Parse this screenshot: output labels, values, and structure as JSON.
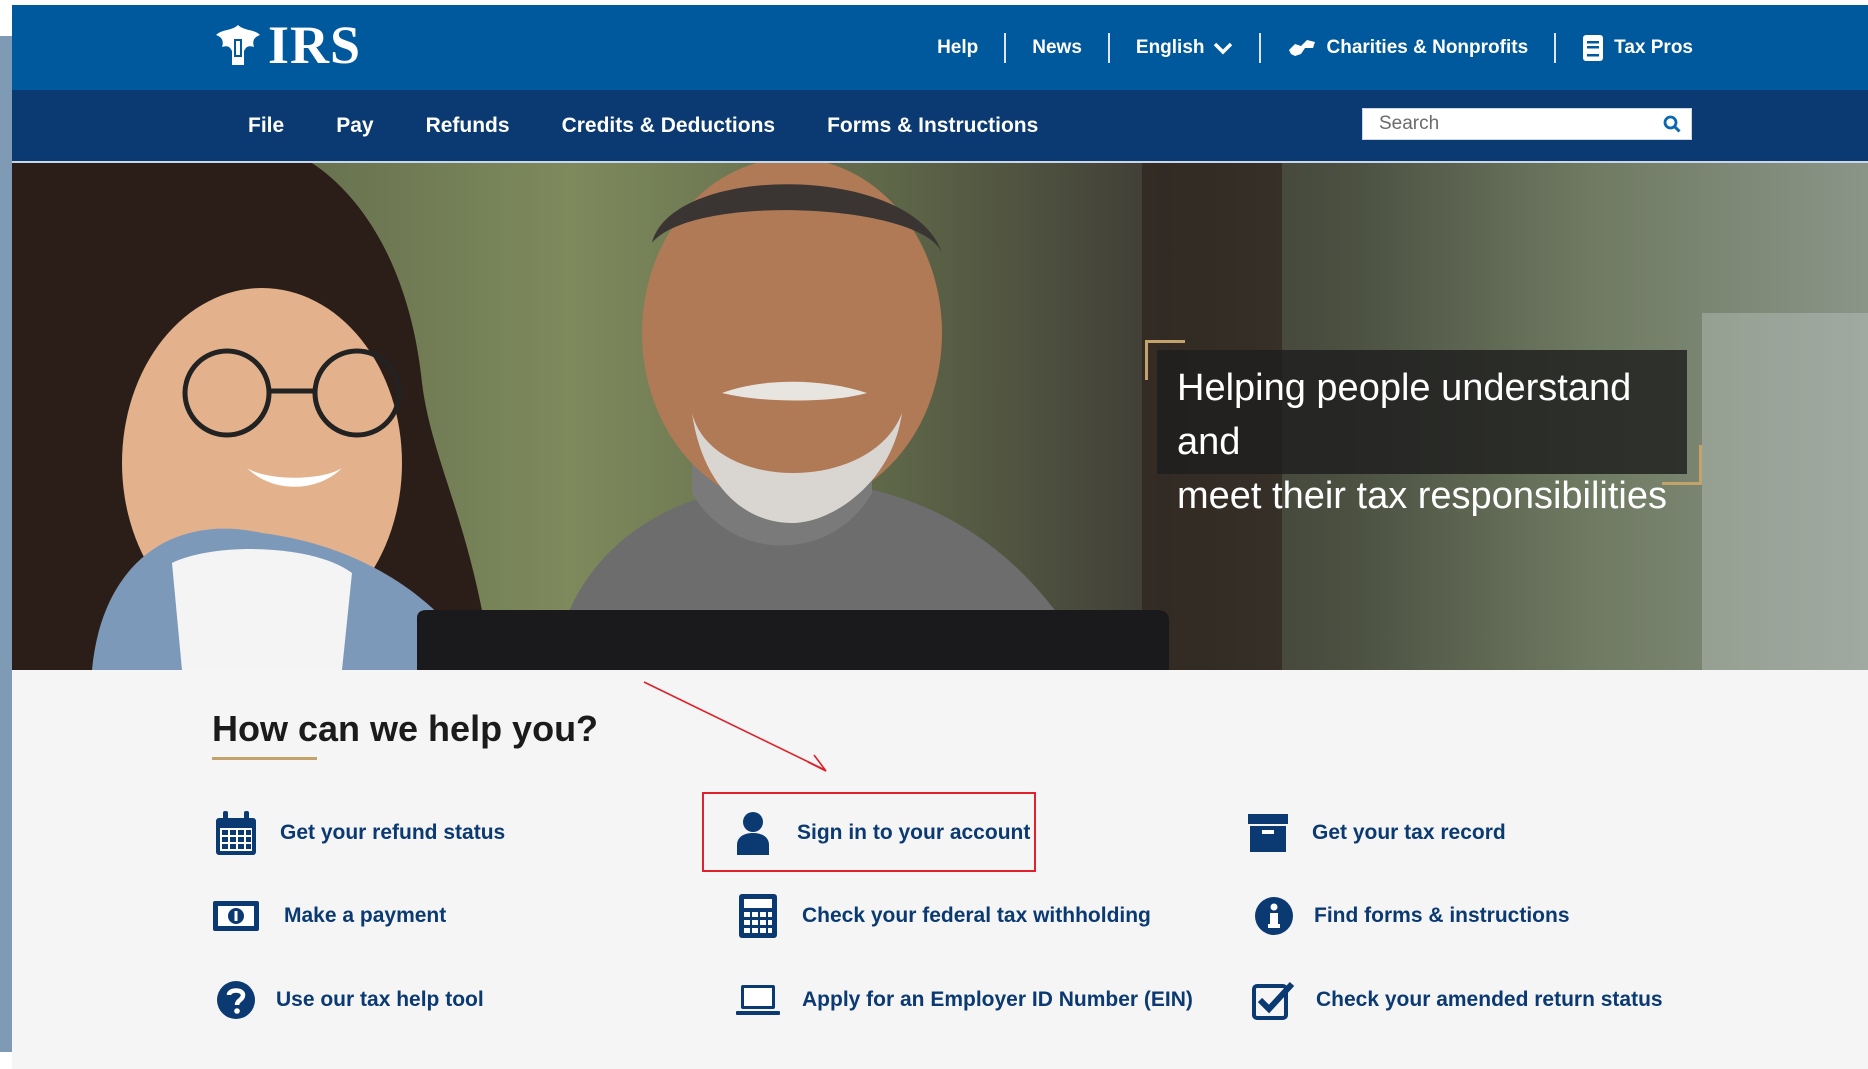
{
  "header": {
    "logo_text": "IRS",
    "utility_links": [
      {
        "label": "Help"
      },
      {
        "label": "News"
      },
      {
        "label": "English"
      },
      {
        "label": "Charities & Nonprofits"
      },
      {
        "label": "Tax Pros"
      }
    ]
  },
  "nav": {
    "items": [
      {
        "label": "File"
      },
      {
        "label": "Pay"
      },
      {
        "label": "Refunds"
      },
      {
        "label": "Credits & Deductions"
      },
      {
        "label": "Forms & Instructions"
      }
    ],
    "search_placeholder": "Search"
  },
  "hero": {
    "tagline_line1": "Helping people understand and",
    "tagline_line2": "meet their tax responsibilities"
  },
  "help": {
    "title": "How can we help you?",
    "links": [
      {
        "label": "Get your refund status",
        "icon": "calendar-icon"
      },
      {
        "label": "Sign in to your account",
        "icon": "user-icon"
      },
      {
        "label": "Get your tax record",
        "icon": "archive-box-icon"
      },
      {
        "label": "Make a payment",
        "icon": "money-bill-icon"
      },
      {
        "label": "Check your federal tax withholding",
        "icon": "calculator-icon"
      },
      {
        "label": "Find forms & instructions",
        "icon": "info-circle-icon"
      },
      {
        "label": "Use our tax help tool",
        "icon": "question-circle-icon"
      },
      {
        "label": "Apply for an Employer ID Number (EIN)",
        "icon": "laptop-icon"
      },
      {
        "label": "Check your amended return status",
        "icon": "checkbox-icon"
      }
    ]
  },
  "colors": {
    "top_bar": "#00599c",
    "main_nav": "#0b3a72",
    "link": "#0b3a72",
    "accent_gold": "#c3a36a",
    "annotation_red": "#e0202a"
  }
}
